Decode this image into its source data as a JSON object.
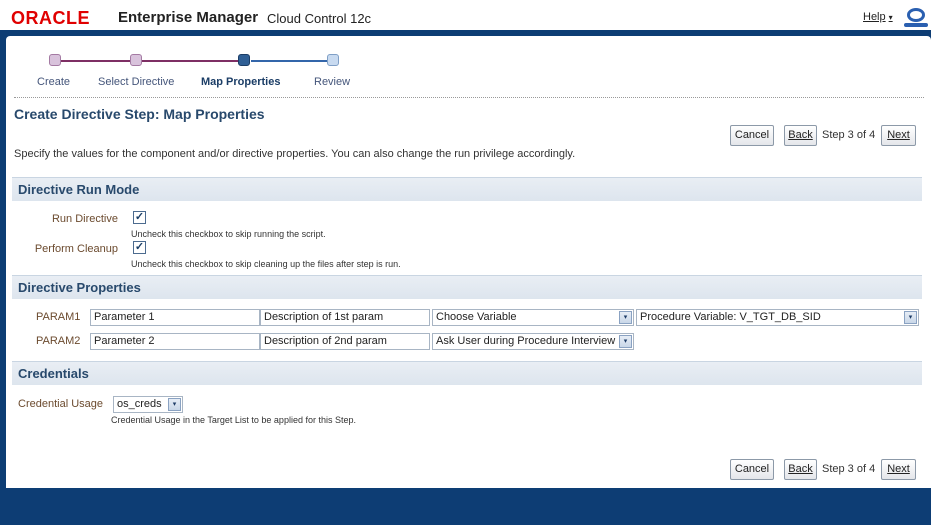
{
  "header": {
    "brand": "ORACLE",
    "product": "Enterprise Manager",
    "edition": "Cloud Control 12c",
    "help_label": "Help",
    "help_caret": "▾"
  },
  "train": {
    "steps": [
      {
        "label": "Create",
        "state": "visited"
      },
      {
        "label": "Select Directive",
        "state": "visited"
      },
      {
        "label": "Map Properties",
        "state": "current"
      },
      {
        "label": "Review",
        "state": "future"
      }
    ]
  },
  "page": {
    "title": "Create Directive Step: Map Properties",
    "description": "Specify the values for the component and/or directive properties. You can also change the run privilege accordingly."
  },
  "nav_top": {
    "cancel": "Cancel",
    "back": "Back",
    "step_text": "Step 3 of 4",
    "next": "Next"
  },
  "nav_bottom": {
    "cancel": "Cancel",
    "back": "Back",
    "step_text": "Step 3 of 4",
    "next": "Next"
  },
  "run_mode": {
    "title": "Directive Run Mode",
    "run_directive": {
      "label": "Run Directive",
      "checked": true,
      "check_glyph": "✓",
      "hint": "Uncheck this checkbox to skip running the script."
    },
    "perform_cleanup": {
      "label": "Perform Cleanup",
      "checked": true,
      "check_glyph": "✓",
      "hint": "Uncheck this checkbox to skip cleaning up the files after step is run."
    }
  },
  "properties": {
    "title": "Directive Properties",
    "rows": [
      {
        "label": "PARAM1",
        "name": "Parameter 1",
        "description": "Description of 1st param",
        "source": "Choose Variable",
        "value": "Procedure Variable: V_TGT_DB_SID"
      },
      {
        "label": "PARAM2",
        "name": "Parameter 2",
        "description": "Description of 2nd param",
        "source": "Ask User during Procedure Interview"
      }
    ]
  },
  "credentials": {
    "title": "Credentials",
    "usage_label": "Credential Usage",
    "usage_value": "os_creds",
    "hint": "Credential Usage in the Target List to be applied for this Step."
  },
  "colors": {
    "frame": "#0d3d74",
    "brand_red": "#e00000",
    "heading": "#28496c",
    "label_brown": "#6b4a2e",
    "train_done": "#7e2f64",
    "train_current": "#2f5f95"
  },
  "icons": {
    "dropdown": "▾",
    "oracle_o": "oracle-o-icon"
  }
}
